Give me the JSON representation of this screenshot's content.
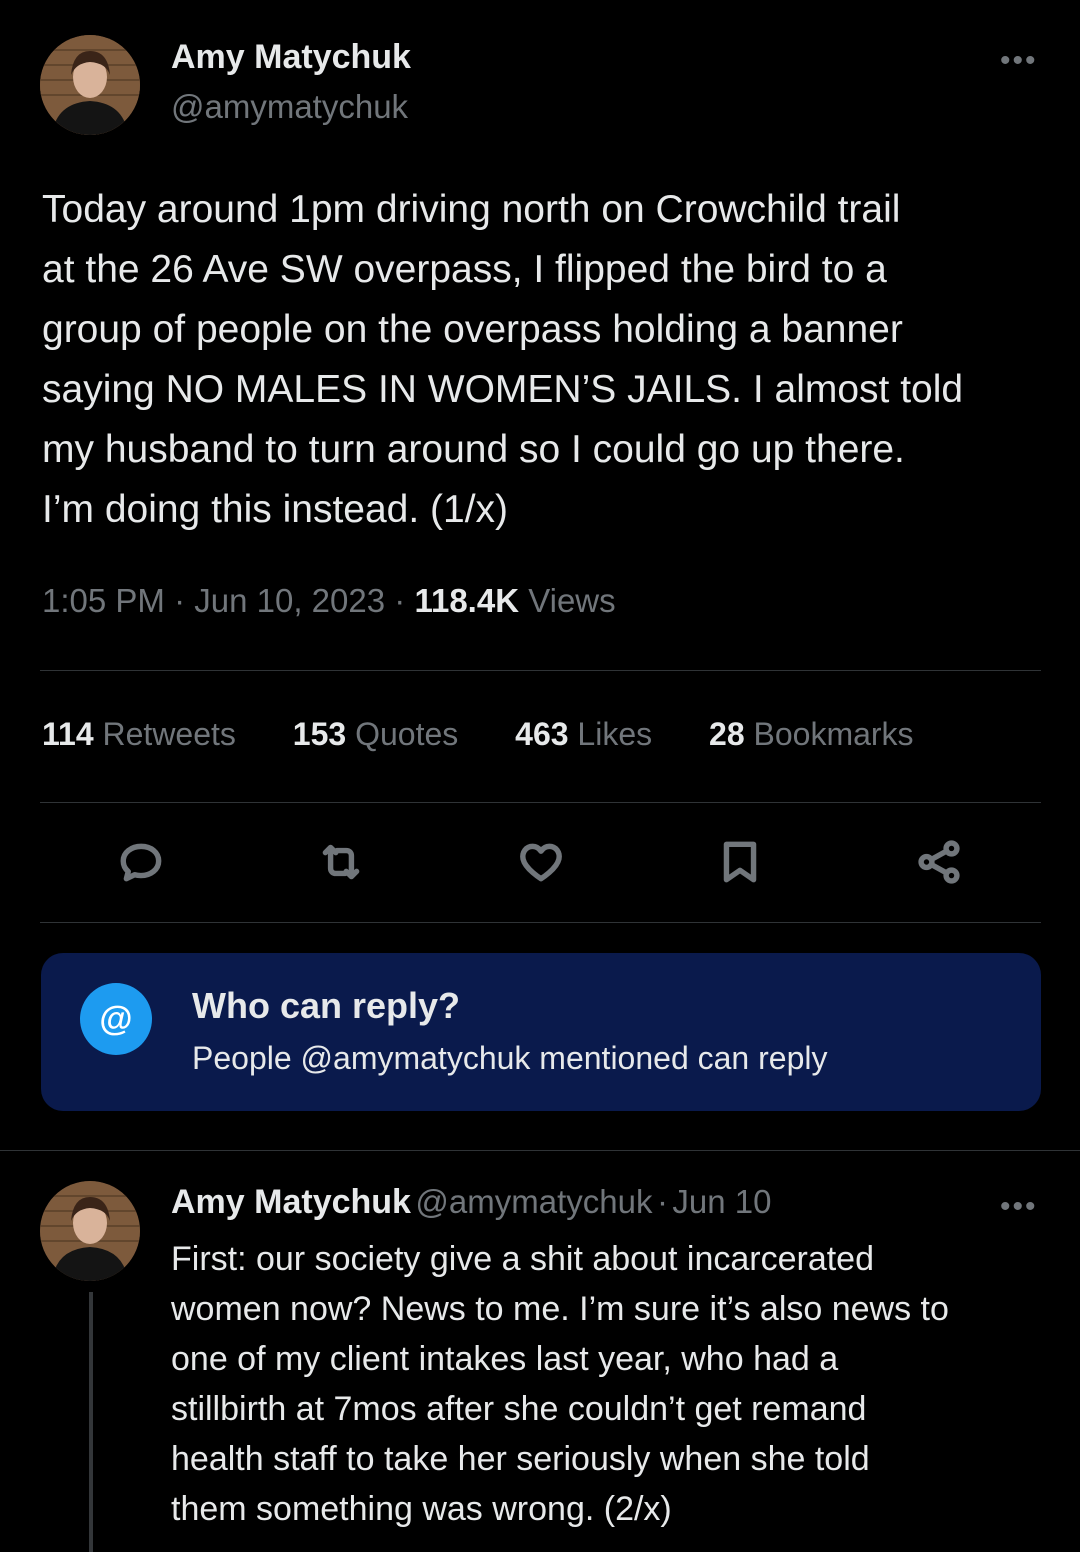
{
  "main_tweet": {
    "author_name": "Amy Matychuk",
    "author_handle": "@amymatychuk",
    "more_label": "•••",
    "text": "Today around 1pm driving north on Crowchild trail\nat the 26 Ave SW overpass, I flipped the bird to a\ngroup of people on the overpass holding a banner\nsaying NO MALES IN WOMEN’S JAILS. I almost told\nmy husband to turn around so I could go up there.\nI’m doing this instead. (1/x)",
    "time": "1:05 PM",
    "separator": "·",
    "date": "Jun 10, 2023",
    "views_count": "118.4K",
    "views_label": "Views"
  },
  "stats": [
    {
      "count": "114",
      "label": "Retweets"
    },
    {
      "count": "153",
      "label": "Quotes"
    },
    {
      "count": "463",
      "label": "Likes"
    },
    {
      "count": "28",
      "label": "Bookmarks"
    }
  ],
  "actions": [
    "reply-icon",
    "retweet-icon",
    "like-icon",
    "bookmark-icon",
    "share-icon"
  ],
  "reply_restriction": {
    "icon_label": "@",
    "title": "Who can reply?",
    "subtitle": "People @amymatychuk mentioned can reply"
  },
  "reply_tweet": {
    "author_name": "Amy Matychuk",
    "author_handle": "@amymatychuk",
    "separator": "·",
    "date": "Jun 10",
    "more_label": "•••",
    "text": "First: our society give a shit about incarcerated\nwomen now? News to me. I’m sure it’s also news to\none of my client intakes last year, who had a\nstillbirth at 7mos after she couldn’t get remand\nhealth staff to take her seriously when she told\nthem something was wrong. (2/x)"
  },
  "colors": {
    "background": "#000000",
    "text_primary": "#e7e9ea",
    "text_secondary": "#71767b",
    "divider": "#2f3336",
    "accent": "#1d9bf0",
    "reply_box": "#0a1a4c"
  }
}
